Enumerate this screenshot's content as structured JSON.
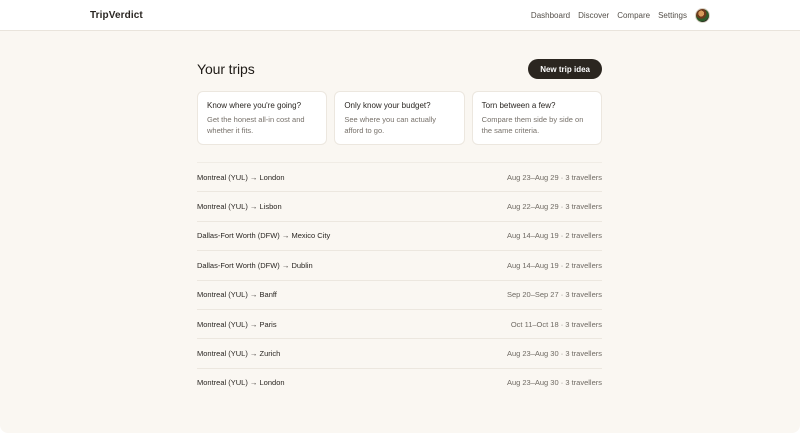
{
  "header": {
    "brand": "TripVerdict",
    "nav": [
      "Dashboard",
      "Discover",
      "Compare",
      "Settings"
    ]
  },
  "main": {
    "title": "Your trips",
    "new_trip_label": "New trip idea",
    "cards": [
      {
        "title": "Know where you're going?",
        "desc": "Get the honest all-in cost and whether it fits."
      },
      {
        "title": "Only know your budget?",
        "desc": "See where you can actually afford to go."
      },
      {
        "title": "Torn between a few?",
        "desc": "Compare them side by side on the same criteria."
      }
    ],
    "trips": [
      {
        "route": "Montreal (YUL) → London",
        "meta": "Aug 23–Aug 29 · 3 travellers"
      },
      {
        "route": "Montreal (YUL) → Lisbon",
        "meta": "Aug 22–Aug 29 · 3 travellers"
      },
      {
        "route": "Dallas-Fort Worth (DFW) → Mexico City",
        "meta": "Aug 14–Aug 19 · 2 travellers"
      },
      {
        "route": "Dallas-Fort Worth (DFW) → Dublin",
        "meta": "Aug 14–Aug 19 · 2 travellers"
      },
      {
        "route": "Montreal (YUL) → Banff",
        "meta": "Sep 20–Sep 27 · 3 travellers"
      },
      {
        "route": "Montreal (YUL) → Paris",
        "meta": "Oct 11–Oct 18 · 3 travellers"
      },
      {
        "route": "Montreal (YUL) → Zurich",
        "meta": "Aug 23–Aug 30 · 3 travellers"
      },
      {
        "route": "Montreal (YUL) → London",
        "meta": "Aug 23–Aug 30 · 3 travellers"
      }
    ]
  },
  "colors": {
    "background": "#faf7f2",
    "primary_button": "#2b2620",
    "card_border": "#ece7df"
  }
}
